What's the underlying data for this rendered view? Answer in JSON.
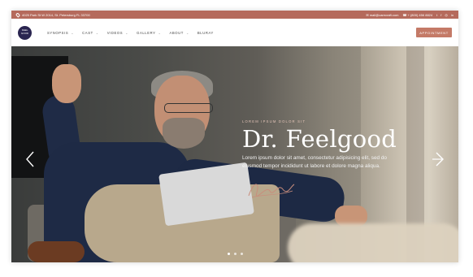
{
  "topbar": {
    "address": "4025 Park St W 2014, St. Petersburg FL 33700",
    "email": "mail@carecraft.com",
    "phone": "+ (800) 456 8824",
    "social": [
      "twitter-icon",
      "facebook-icon",
      "instagram-icon",
      "linkedin-icon"
    ]
  },
  "logo": {
    "line1": "FEEL",
    "line2": "GOOD"
  },
  "nav": {
    "items": [
      "SYNOPSIS",
      "CAST",
      "VIDEOS",
      "GALLERY",
      "ABOUT",
      "BLURAY"
    ],
    "appointment": "APPOINTMENT"
  },
  "hero": {
    "eyebrow": "LOREM IPSUM DOLOR SIT",
    "title": "Dr. Feelgood",
    "description": "Lorem ipsum dolor sit amet, consectetur adipisicing elit, sed do eiusmod tempor incididunt ut labore et dolore magna aliqua.",
    "slides": 3,
    "active_slide": 1
  },
  "colors": {
    "accent": "#b56a5c",
    "button": "#c47a67",
    "logo": "#2a2550"
  }
}
